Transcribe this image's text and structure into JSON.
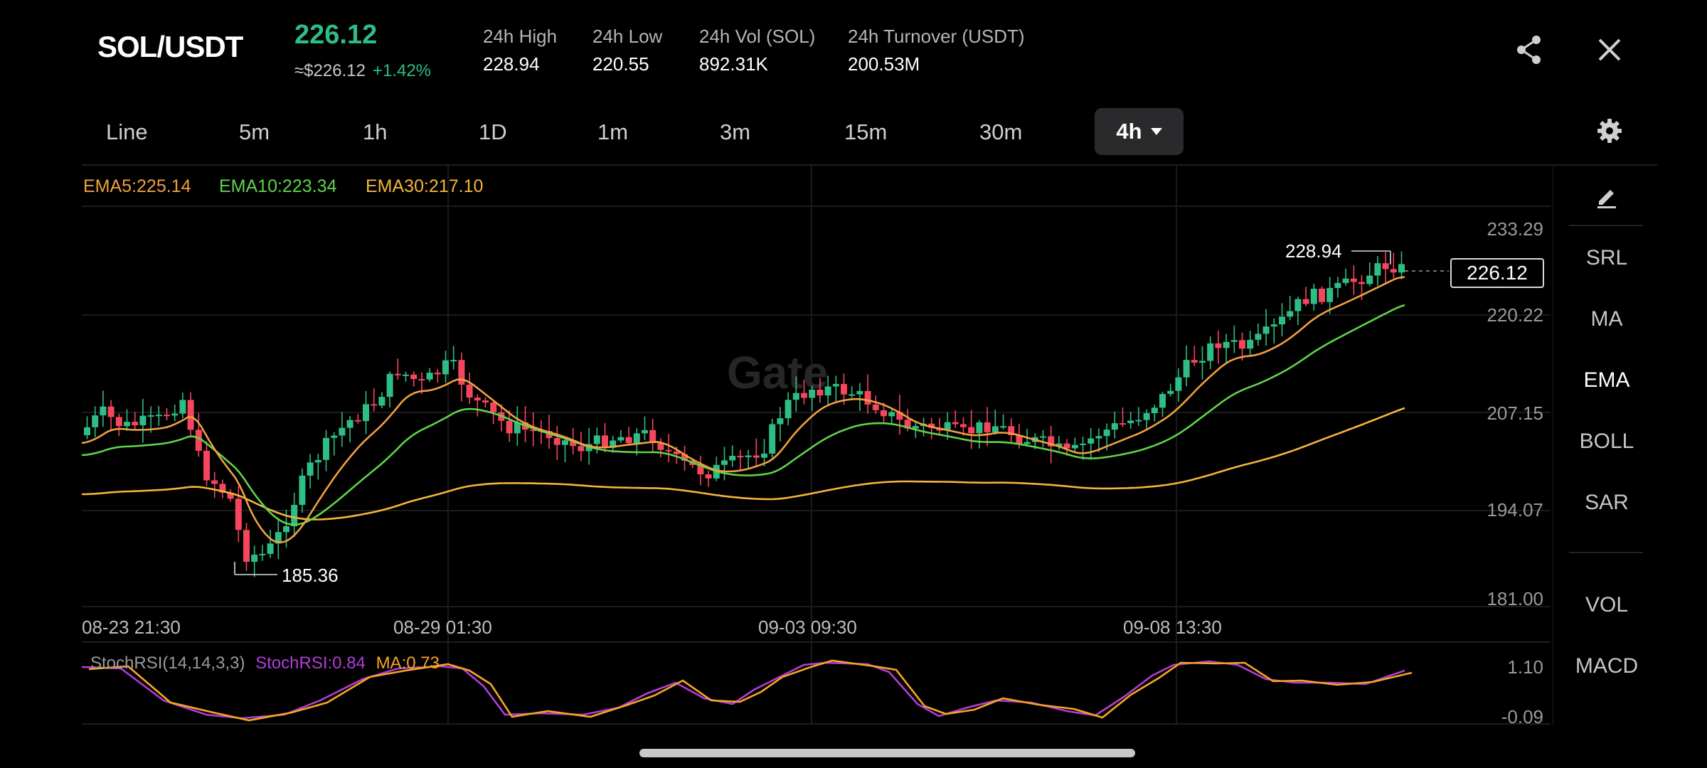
{
  "header": {
    "pair": "SOL/USDT",
    "price": "226.12",
    "approx_price": "≈$226.12",
    "change": "+1.42%",
    "stats": [
      {
        "label": "24h High",
        "value": "228.94"
      },
      {
        "label": "24h Low",
        "value": "220.55"
      },
      {
        "label": "24h Vol (SOL)",
        "value": "892.31K"
      },
      {
        "label": "24h Turnover (USDT)",
        "value": "200.53M"
      }
    ],
    "share_icon": "share-icon",
    "close_icon": "close-icon"
  },
  "timeframes": {
    "items": [
      "Line",
      "5m",
      "1h",
      "1D",
      "1m",
      "3m",
      "15m",
      "30m"
    ],
    "active": "4h"
  },
  "legend": {
    "ema5": "EMA5:225.14",
    "ema10": "EMA10:223.34",
    "ema30": "EMA30:217.10"
  },
  "chart": {
    "y_labels": [
      "233.29",
      "220.22",
      "207.15",
      "194.07",
      "181.00"
    ],
    "x_labels": [
      "08-23 21:30",
      "08-29 01:30",
      "09-03 09:30",
      "09-08 13:30"
    ],
    "high_marker": "228.94",
    "low_marker": "185.36",
    "current_price": "226.12",
    "watermark": "Gate"
  },
  "rsi": {
    "title": "StochRSI(14,14,3,3)",
    "stochrsi": "StochRSI:0.84",
    "ma": "MA:0.73",
    "y_labels": [
      "1.10",
      "-0.09"
    ]
  },
  "indicators": {
    "main": [
      "SRL",
      "MA",
      "EMA",
      "BOLL",
      "SAR"
    ],
    "active": "EMA",
    "sub": [
      "VOL",
      "MACD"
    ],
    "draw_icon": "pencil-icon"
  },
  "colors": {
    "up": "#2ebd85",
    "down": "#f6465d",
    "ema5": "#f0a040",
    "ema10": "#5fd34a",
    "ema30": "#f5b43c",
    "stoch": "#b23dd8",
    "ma": "#f5a623"
  }
}
